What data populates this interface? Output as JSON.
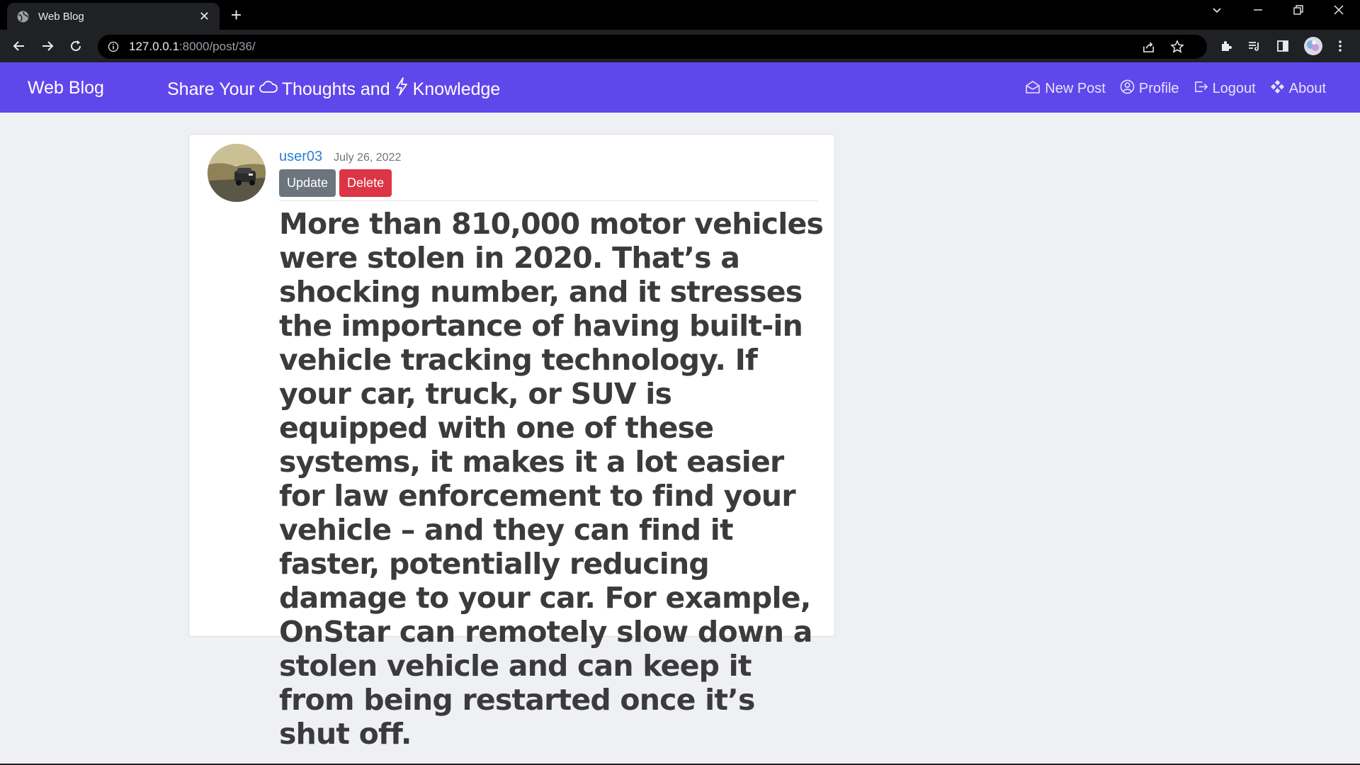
{
  "browser": {
    "tab_title": "Web Blog",
    "tab_close": "✕",
    "new_tab": "+",
    "url_host": "127.0.0.1",
    "url_path": ":8000/post/36/"
  },
  "navbar": {
    "brand": "Web Blog",
    "tagline_part1": "Share Your",
    "tagline_part2": "Thoughts and",
    "tagline_part3": "Knowledge",
    "links": [
      {
        "label": "New Post",
        "icon": "envelope-open-icon"
      },
      {
        "label": "Profile",
        "icon": "person-circle-icon"
      },
      {
        "label": "Logout",
        "icon": "box-arrow-right-icon"
      },
      {
        "label": "About",
        "icon": "diamond-grid-icon"
      }
    ],
    "color": "#6047ec"
  },
  "post": {
    "author": "user03",
    "date": "July 26, 2022",
    "update_label": "Update",
    "delete_label": "Delete",
    "content": "More than 810,000 motor vehicles were stolen in 2020. That’s a shocking number, and it stresses the importance of having built-in vehicle tracking technology. If your car, truck, or SUV is equipped with one of these systems, it makes it a lot easier for law enforcement to find your vehicle – and they can find it faster, potentially reducing damage to your car. For example, OnStar can remotely slow down a stolen vehicle and can keep it from being restarted once it’s shut off."
  }
}
